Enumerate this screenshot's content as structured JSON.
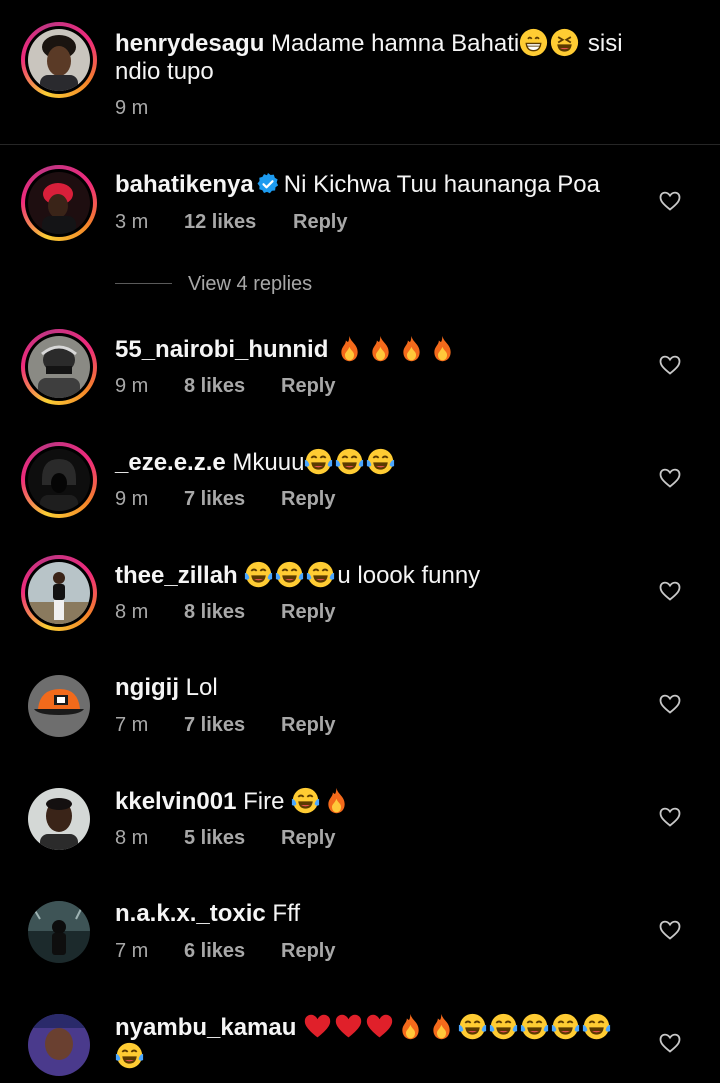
{
  "caption": {
    "username": "henrydesagu",
    "text_part1": " Madame hamna Bahati",
    "emojis_1": [
      "grin-emoji",
      "squint-laugh-emoji"
    ],
    "text_part2": " sisi",
    "text_line2": "ndio tupo",
    "time": "9 m"
  },
  "comments": [
    {
      "username": "bahatikenya",
      "verified": true,
      "text": "Ni Kichwa Tuu haunanga Poa",
      "emojis": [],
      "time": "3 m",
      "likes": "12 likes",
      "reply": "Reply"
    },
    {
      "username": "55_nairobi_hunnid",
      "verified": false,
      "text": "",
      "emojis": [
        "fire-emoji",
        "fire-emoji",
        "fire-emoji",
        "fire-emoji"
      ],
      "time": "9 m",
      "likes": "8 likes",
      "reply": "Reply"
    },
    {
      "username": "_eze.e.z.e",
      "verified": false,
      "text": "Mkuuu",
      "emojis": [
        "tears-of-joy-emoji",
        "tears-of-joy-emoji",
        "tears-of-joy-emoji"
      ],
      "time": "9 m",
      "likes": "7 likes",
      "reply": "Reply"
    },
    {
      "username": "thee_zillah",
      "verified": false,
      "text": "",
      "emojis": [
        "tears-of-joy-emoji",
        "tears-of-joy-emoji",
        "tears-of-joy-emoji"
      ],
      "text_after": "u loook funny",
      "time": "8 m",
      "likes": "8 likes",
      "reply": "Reply"
    },
    {
      "username": "ngigij",
      "verified": false,
      "text": "Lol",
      "emojis": [],
      "time": "7 m",
      "likes": "7 likes",
      "reply": "Reply"
    },
    {
      "username": "kkelvin001",
      "verified": false,
      "text": "Fire",
      "emojis": [
        "tears-of-joy-emoji",
        "fire-emoji"
      ],
      "time": "8 m",
      "likes": "5 likes",
      "reply": "Reply"
    },
    {
      "username": "n.a.k.x._toxic",
      "verified": false,
      "text": "Fff",
      "emojis": [],
      "time": "7 m",
      "likes": "6 likes",
      "reply": "Reply"
    },
    {
      "username": "nyambu_kamau",
      "verified": false,
      "text": "",
      "emojis": [
        "heart-emoji",
        "heart-emoji",
        "heart-emoji",
        "fire-emoji",
        "fire-emoji",
        "tears-of-joy-emoji",
        "tears-of-joy-emoji",
        "tears-of-joy-emoji",
        "tears-of-joy-emoji",
        "tears-of-joy-emoji",
        "tears-of-joy-emoji"
      ],
      "time": "",
      "likes": "",
      "reply": ""
    }
  ],
  "view_replies": "View 4 replies",
  "colors": {
    "background": "#000000",
    "text": "#f5f5f5",
    "secondary": "#a8a8a8",
    "verified": "#1d9bf0",
    "ring_start": "#f9ce34",
    "ring_end": "#ee2a7b"
  }
}
